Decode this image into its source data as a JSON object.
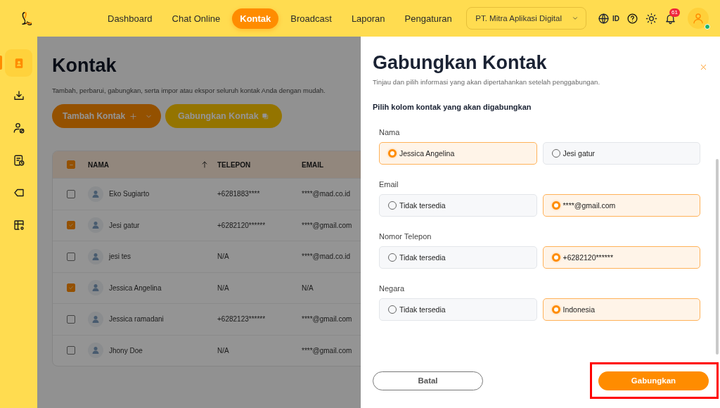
{
  "top_nav": {
    "tabs": [
      {
        "label": "Dashboard",
        "selected": false
      },
      {
        "label": "Chat Online",
        "selected": false
      },
      {
        "label": "Kontak",
        "selected": true
      },
      {
        "label": "Broadcast",
        "selected": false
      },
      {
        "label": "Laporan",
        "selected": false
      },
      {
        "label": "Pengaturan",
        "selected": false
      }
    ],
    "org_select": {
      "value": "PT. Mitra Aplikasi Digital"
    },
    "language": "ID",
    "notification_count": "61",
    "user_online": true
  },
  "sidebar": {
    "items": [
      {
        "kind": "contacts",
        "selected": true
      },
      {
        "kind": "import",
        "selected": false
      },
      {
        "kind": "user-block",
        "selected": false
      },
      {
        "kind": "report",
        "selected": false
      },
      {
        "kind": "tag",
        "selected": false
      },
      {
        "kind": "table-settings",
        "selected": false
      }
    ]
  },
  "page": {
    "title": "Kontak",
    "subtitle": "Tambah, perbarui, gabungkan, serta impor atau ekspor seluruh kontak Anda dengan mudah.",
    "add_button": "Tambah Kontak",
    "merge_button": "Gabungkan Kontak"
  },
  "table": {
    "select_all_indeterminate": true,
    "columns": [
      "NAMA",
      "TELEPON",
      "EMAIL"
    ],
    "rows": [
      {
        "name": "Eko Sugiarto",
        "phone": "+6281883****",
        "email": "****@mad.co.id",
        "selected": false
      },
      {
        "name": "Jesi gatur",
        "phone": "+6282120******",
        "email": "****@gmail.com",
        "selected": true
      },
      {
        "name": "jesi tes",
        "phone": "N/A",
        "email": "****@mad.co.id",
        "selected": false
      },
      {
        "name": "Jessica Angelina",
        "phone": "N/A",
        "email": "N/A",
        "selected": true
      },
      {
        "name": "Jessica ramadani",
        "phone": "+6282123******",
        "email": "****@gmail.com",
        "selected": false
      },
      {
        "name": "Jhony Doe",
        "phone": "N/A",
        "email": "****@gmail.com",
        "selected": false
      }
    ]
  },
  "drawer": {
    "title": "Gabungkan Kontak",
    "subtitle": "Tinjau dan pilih informasi yang akan dipertahankan setelah penggabungan.",
    "section_heading": "Pilih kolom kontak yang akan digabungkan",
    "groups": [
      {
        "label": "Nama",
        "options": [
          {
            "text": "Jessica Angelina",
            "selected": true
          },
          {
            "text": "Jesi gatur",
            "selected": false
          }
        ]
      },
      {
        "label": "Email",
        "options": [
          {
            "text": "Tidak tersedia",
            "selected": false
          },
          {
            "text": "****@gmail.com",
            "selected": true
          }
        ]
      },
      {
        "label": "Nomor Telepon",
        "options": [
          {
            "text": "Tidak tersedia",
            "selected": false
          },
          {
            "text": "+6282120******",
            "selected": true
          }
        ]
      },
      {
        "label": "Negara",
        "options": [
          {
            "text": "Tidak tersedia",
            "selected": false
          },
          {
            "text": "Indonesia",
            "selected": true
          }
        ]
      }
    ],
    "cancel_button": "Batal",
    "confirm_button": "Gabungkan",
    "confirm_highlighted": true
  }
}
